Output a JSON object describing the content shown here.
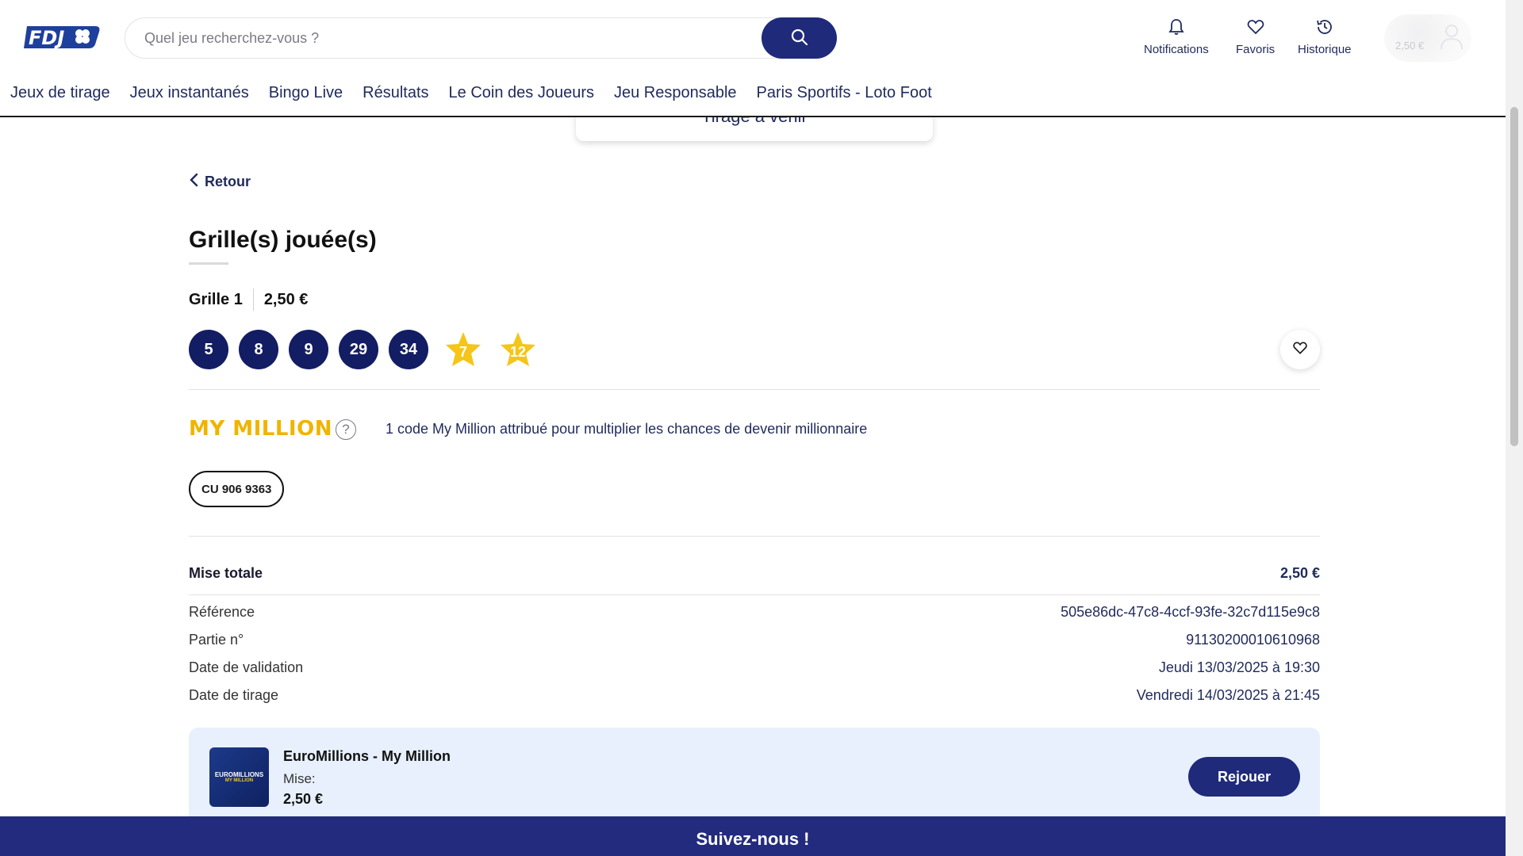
{
  "header": {
    "logo_text": "FDJ",
    "search_placeholder": "Quel jeu recherchez-vous ?",
    "actions": [
      {
        "label": "Notifications",
        "icon": "bell-icon"
      },
      {
        "label": "Favoris",
        "icon": "heart-icon"
      },
      {
        "label": "Historique",
        "icon": "history-icon"
      }
    ],
    "account_balance": "2,50 €"
  },
  "nav": {
    "items": [
      "Jeux de tirage",
      "Jeux instantanés",
      "Bingo Live",
      "Résultats",
      "Le Coin des Joueurs",
      "Jeu Responsable",
      "Paris Sportifs - Loto Foot"
    ]
  },
  "popup": {
    "label": "Tirage à venir"
  },
  "page": {
    "back_label": "Retour",
    "title": "Grille(s) jouée(s)",
    "grille_label": "Grille 1",
    "grille_price": "2,50 €",
    "numbers": [
      "5",
      "8",
      "9",
      "29",
      "34"
    ],
    "stars": [
      "7",
      "12"
    ],
    "mymillion": {
      "logo": "MY MILLION",
      "help": "?",
      "text": "1 code My Million attribué pour multiplier les chances de devenir millionnaire",
      "code": "CU 906 9363"
    },
    "details": {
      "mise_totale_label": "Mise totale",
      "mise_totale_value": "2,50 €",
      "reference_label": "Référence",
      "reference_value": "505e86dc-47c8-4ccf-93fe-32c7d115e9c8",
      "partie_label": "Partie n°",
      "partie_value": "91130200010610968",
      "validation_label": "Date de validation",
      "validation_value": "Jeudi 13/03/2025 à 19:30",
      "tirage_label": "Date de tirage",
      "tirage_value": "Vendredi 14/03/2025 à 21:45"
    },
    "card": {
      "logo_text": "EUROMILLIONS",
      "logo_sub": "MY MILLION",
      "title": "EuroMillions - My Million",
      "mise_label": "Mise:",
      "mise_value": "2,50 €",
      "button": "Rejouer"
    }
  },
  "footer": {
    "title": "Suivez-nous !"
  },
  "colors": {
    "primary": "#1f2a7a",
    "ball": "#131d63",
    "star": "#f5c518",
    "mymillion": "#f0b400",
    "card_bg": "#e7f0fc"
  }
}
